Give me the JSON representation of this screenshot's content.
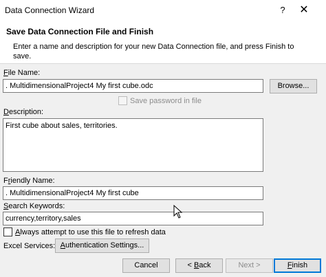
{
  "window": {
    "title": "Data Connection Wizard",
    "help_glyph": "?",
    "close_glyph": "✕"
  },
  "header": {
    "title": "Save Data Connection File and Finish",
    "description": "Enter a name and description for your new Data Connection file, and press Finish to save."
  },
  "file_name": {
    "label_access": "F",
    "label_rest": "ile Name:",
    "value": ". MultidimensionalProject4 My first cube.odc",
    "browse_label": "Browse..."
  },
  "save_password": {
    "label": "Save password in file",
    "checked": false,
    "enabled": false
  },
  "description": {
    "label_access": "D",
    "label_rest": "escription:",
    "value": "First cube about sales, territories."
  },
  "friendly_name": {
    "label_pre": "F",
    "label_access": "r",
    "label_rest": "iendly Name:",
    "value": ". MultidimensionalProject4 My first cube"
  },
  "search_keywords": {
    "label_access": "S",
    "label_rest": "earch Keywords:",
    "value": "currency,territory,sales"
  },
  "always_refresh": {
    "label_access": "A",
    "label_rest": "lways attempt to use this file to refresh data",
    "checked": false
  },
  "excel_services": {
    "label": "Excel Services:",
    "auth_button_access": "A",
    "auth_button_rest": "uthentication Settings..."
  },
  "footer": {
    "cancel_label": "Cancel",
    "back_prefix": "< ",
    "back_access": "B",
    "back_rest": "ack",
    "next_label": "Next >",
    "finish_access": "F",
    "finish_rest": "inish"
  }
}
